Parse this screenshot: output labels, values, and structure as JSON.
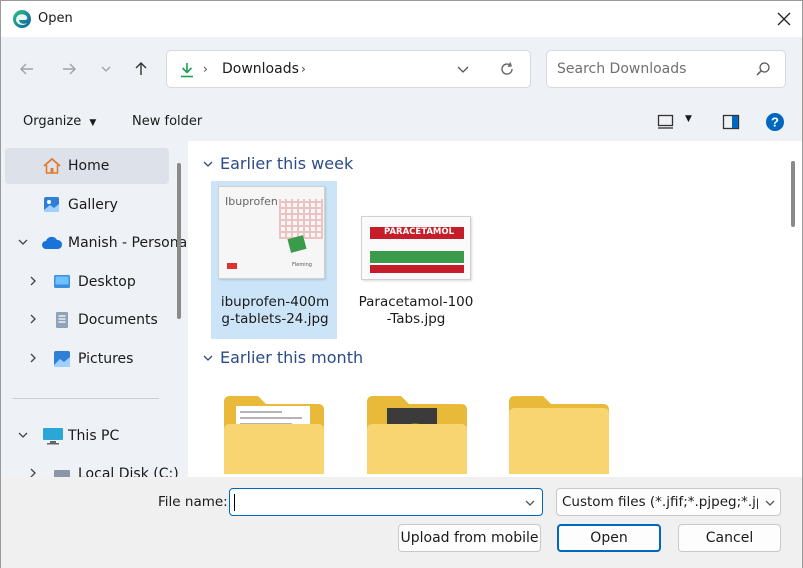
{
  "window": {
    "title": "Open"
  },
  "nav": {
    "breadcrumb": [
      "Downloads"
    ],
    "search_placeholder": "Search Downloads"
  },
  "toolbar": {
    "organize_label": "Organize",
    "new_folder_label": "New folder"
  },
  "sidebar": {
    "items": [
      {
        "label": "Home"
      },
      {
        "label": "Gallery"
      },
      {
        "label": "Manish - Personal"
      },
      {
        "label": "Desktop"
      },
      {
        "label": "Documents"
      },
      {
        "label": "Pictures"
      },
      {
        "label": "This PC"
      },
      {
        "label": "Local Disk (C:)"
      }
    ]
  },
  "content": {
    "groups": [
      {
        "title": "Earlier this week"
      },
      {
        "title": "Earlier this month"
      }
    ],
    "files": [
      {
        "name_line1": "ibuprofen-400m",
        "name_line2": "g-tablets-24.jpg",
        "thumb_title": "Ibuprofen",
        "thumb_sub": "Fleming"
      },
      {
        "name_line1": "Paracetamol-100",
        "name_line2": "-Tabs.jpg",
        "thumb_title": "PARACETAMOL"
      }
    ]
  },
  "footer": {
    "file_name_label": "File name:",
    "file_name_value": "",
    "filter_value": "Custom files (*.jfif;*.pjpeg;*.jpe",
    "upload_label": "Upload from mobile",
    "open_label": "Open",
    "cancel_label": "Cancel"
  },
  "colors": {
    "accent": "#0067c0",
    "group_heading": "#2b4a8a",
    "sidebar_bg": "#eef1f5",
    "selected_bg": "#dde2ea"
  }
}
